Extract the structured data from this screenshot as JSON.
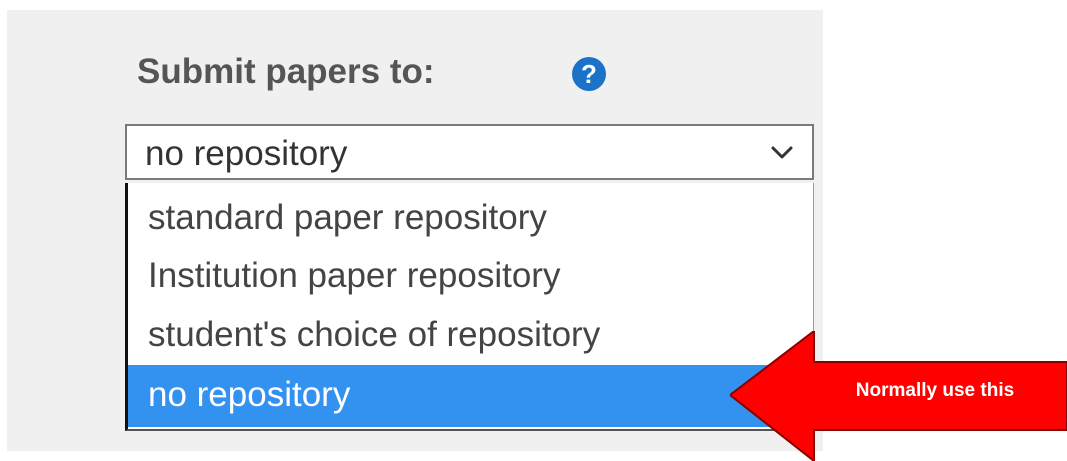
{
  "form": {
    "heading": "Submit papers to:",
    "help_icon": "question-icon",
    "help_glyph": "?",
    "selected_value": "no repository"
  },
  "dropdown": {
    "options": [
      {
        "label": "standard paper repository",
        "selected": false
      },
      {
        "label": "Institution paper repository",
        "selected": false
      },
      {
        "label": "student's choice of repository",
        "selected": false
      },
      {
        "label": "no repository",
        "selected": true
      }
    ],
    "highlight_color": "#3392f0"
  },
  "callout": {
    "text": "Normally use this",
    "color": "#ff0000",
    "icon": "left-arrow-icon"
  }
}
